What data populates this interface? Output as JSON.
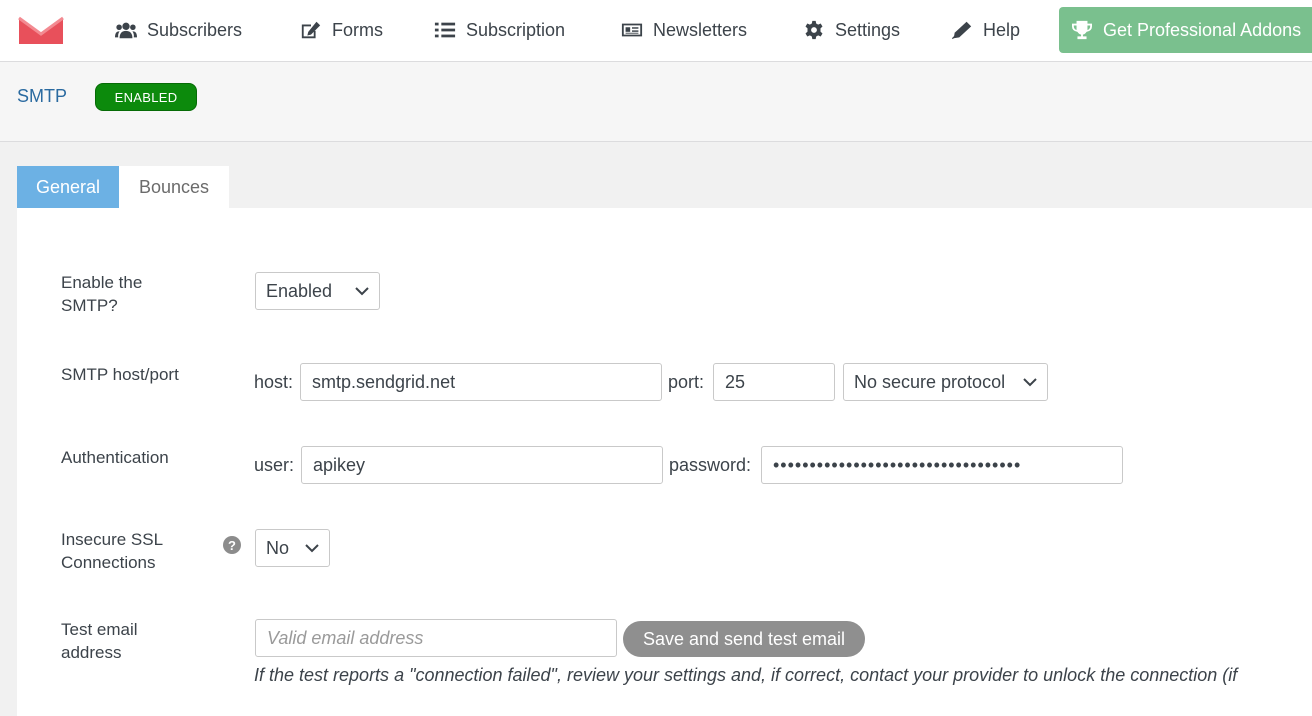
{
  "nav": {
    "items": [
      {
        "label": "Subscribers",
        "icon": "users-icon"
      },
      {
        "label": "Forms",
        "icon": "edit-icon"
      },
      {
        "label": "Subscription",
        "icon": "list-icon"
      },
      {
        "label": "Newsletters",
        "icon": "newspaper-icon"
      },
      {
        "label": "Settings",
        "icon": "gear-icon"
      },
      {
        "label": "Help",
        "icon": "pen-icon"
      }
    ],
    "pro_button": "Get Professional Addons",
    "logo_color": "#e8505b"
  },
  "header": {
    "title": "SMTP",
    "status": "ENABLED",
    "status_color": "#0c8a0c"
  },
  "tabs": [
    {
      "label": "General",
      "active": true
    },
    {
      "label": "Bounces",
      "active": false
    }
  ],
  "form": {
    "enable": {
      "label": "Enable the SMTP?",
      "value": "Enabled"
    },
    "host": {
      "label": "SMTP host/port",
      "host_label": "host:",
      "host_value": "smtp.sendgrid.net",
      "port_label": "port:",
      "port_value": "25",
      "secure_value": "No secure protocol"
    },
    "auth": {
      "label": "Authentication",
      "user_label": "user:",
      "user_value": "apikey",
      "password_label": "password:",
      "password_value": "••••••••••••••••••••••••••••••••••"
    },
    "insecure": {
      "label": "Insecure SSL Connections",
      "value": "No",
      "help": "?"
    },
    "test": {
      "label": "Test email address",
      "placeholder": "Valid email address",
      "button": "Save and send test email",
      "hint": "If the test reports a \"connection failed\", review your settings and, if correct, contact your provider to unlock the connection (if"
    }
  }
}
